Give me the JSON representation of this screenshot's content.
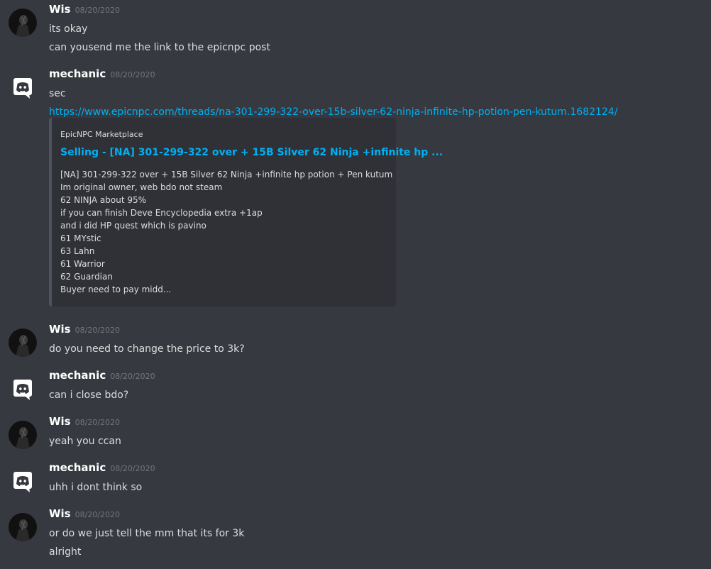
{
  "colors": {
    "background": "#36393f",
    "embed_background": "#2f3136",
    "embed_border": "#4f545c",
    "link": "#00b0f4",
    "username": "#ffffff",
    "text": "#dcddde",
    "timestamp": "#72767d"
  },
  "messages": [
    {
      "username": "Wis",
      "avatar_icon": "user-avatar-icon",
      "timestamp": "08/20/2020",
      "lines": [
        "its okay",
        "can yousend me the link to the epicnpc post"
      ]
    },
    {
      "username": "mechanic",
      "avatar_icon": "discord-logo-icon",
      "timestamp": "08/20/2020",
      "lines": [
        "sec"
      ],
      "link": "https://www.epicnpc.com/threads/na-301-299-322-over-15b-silver-62-ninja-infinite-hp-potion-pen-kutum.1682124/",
      "embed": {
        "provider": "EpicNPC Marketplace",
        "title": "Selling - [NA] 301-299-322 over + 15B Silver 62 Ninja +infinite hp ...",
        "description": [
          "[NA] 301-299-322 over + 15B Silver 62 Ninja +infinite hp potion + Pen kutum",
          "Im original owner, web bdo not steam",
          "62 NINJA about 95%",
          "if you can finish Deve Encyclopedia extra +1ap",
          "and i did HP quest which is pavino",
          "61 MYstic",
          "63 Lahn",
          "61 Warrior",
          "62 Guardian",
          "Buyer need to pay midd..."
        ]
      }
    },
    {
      "username": "Wis",
      "avatar_icon": "user-avatar-icon",
      "timestamp": "08/20/2020",
      "lines": [
        "do you need to change the price to 3k?"
      ]
    },
    {
      "username": "mechanic",
      "avatar_icon": "discord-logo-icon",
      "timestamp": "08/20/2020",
      "lines": [
        "can i close bdo?"
      ]
    },
    {
      "username": "Wis",
      "avatar_icon": "user-avatar-icon",
      "timestamp": "08/20/2020",
      "lines": [
        "yeah you ccan"
      ]
    },
    {
      "username": "mechanic",
      "avatar_icon": "discord-logo-icon",
      "timestamp": "08/20/2020",
      "lines": [
        "uhh i dont think so"
      ]
    },
    {
      "username": "Wis",
      "avatar_icon": "user-avatar-icon",
      "timestamp": "08/20/2020",
      "lines": [
        "or do we just tell the mm that its for 3k",
        "alright"
      ]
    }
  ]
}
